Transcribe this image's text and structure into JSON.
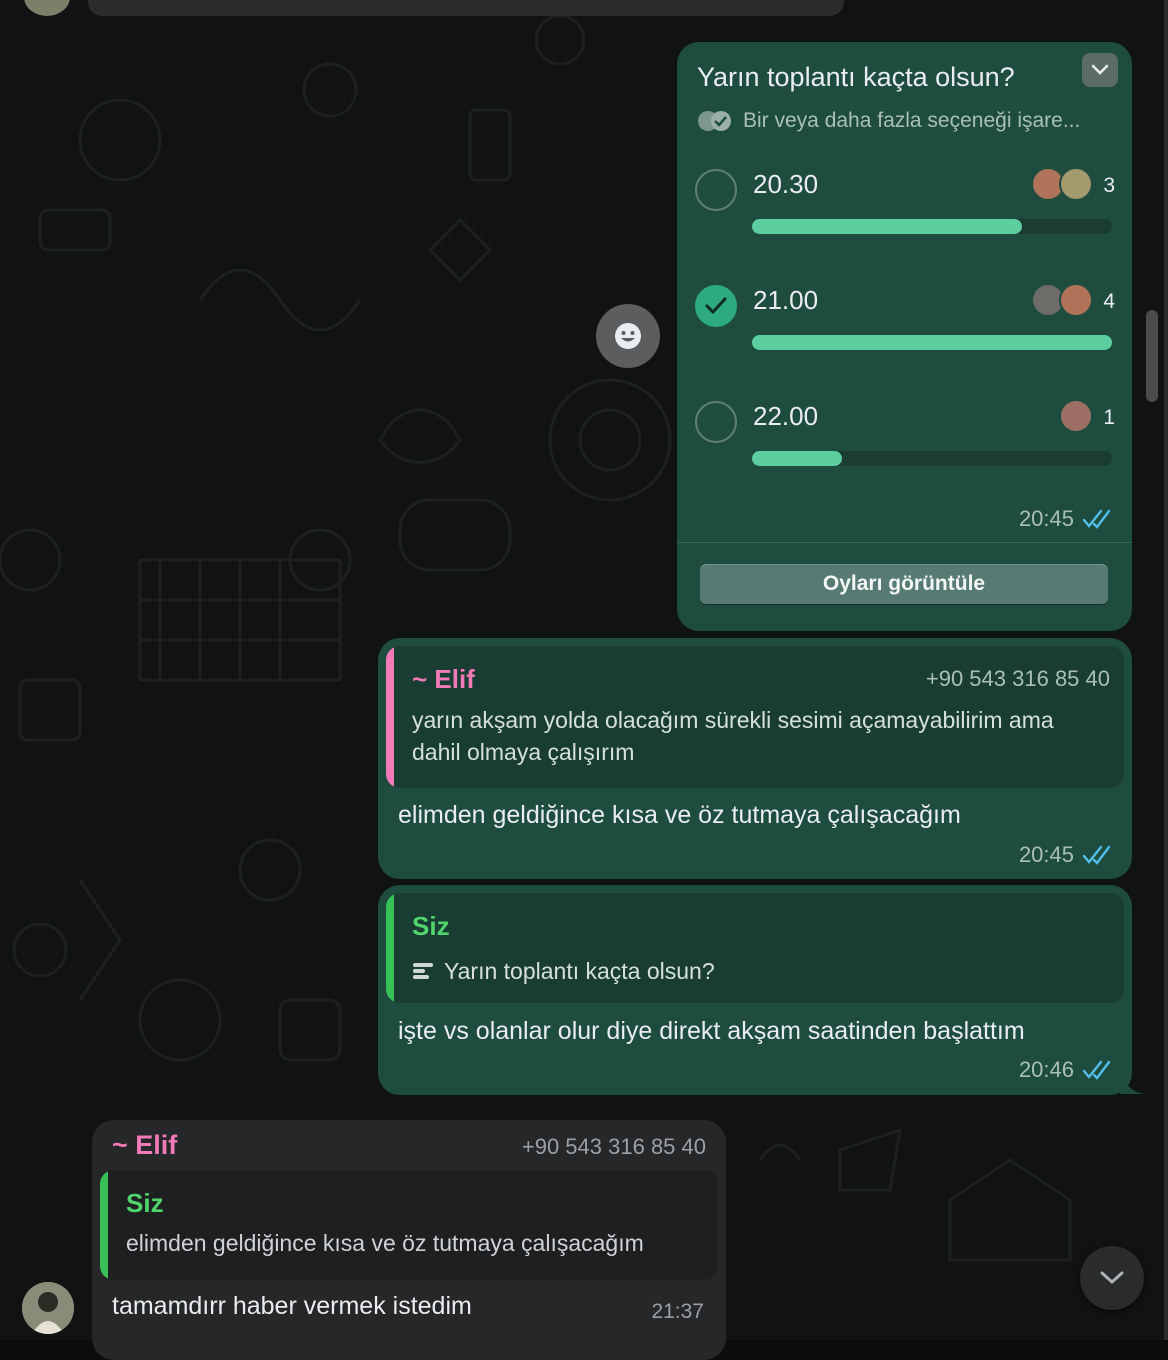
{
  "poll": {
    "question": "Yarın toplantı kaçta olsun?",
    "subtitle": "Bir veya daha fazla seçeneği işare...",
    "options": [
      {
        "label": "20.30",
        "votes": "3",
        "share": 0.75,
        "checked": false
      },
      {
        "label": "21.00",
        "votes": "4",
        "share": 1.0,
        "checked": true
      },
      {
        "label": "22.00",
        "votes": "1",
        "share": 0.25,
        "checked": false
      }
    ],
    "time": "20:45",
    "view_votes_label": "Oyları görüntüle"
  },
  "messages": [
    {
      "quote_name": "~ Elif",
      "quote_phone": "+90 543 316 85 40",
      "quote_line1": "yarın akşam yolda olacağım sürekli sesimi açamayabilirim ama",
      "quote_line2": "dahil olmaya çalışırım",
      "text": "elimden geldiğince kısa ve öz tutmaya çalışacağım",
      "time": "20:45"
    },
    {
      "quote_name": "Siz",
      "quote_text": "Yarın toplantı kaçta olsun?",
      "text": "işte vs olanlar olur diye direkt akşam saatinden başlattım",
      "time": "20:46"
    }
  ],
  "incoming": {
    "name": "~ Elif",
    "phone": "+90 543 316 85 40",
    "quote_name": "Siz",
    "quote_text": "elimden geldiğince kısa ve öz tutmaya çalışacağım",
    "text": "tamamdırr haber vermek istedim",
    "time": "21:37"
  },
  "colors": {
    "outgoing_bubble": "#1e4d40",
    "incoming_bubble": "#262728",
    "accent_green": "#5ccea0",
    "elif_pink": "#f37ab8",
    "read_tick_blue": "#53bdeb"
  }
}
